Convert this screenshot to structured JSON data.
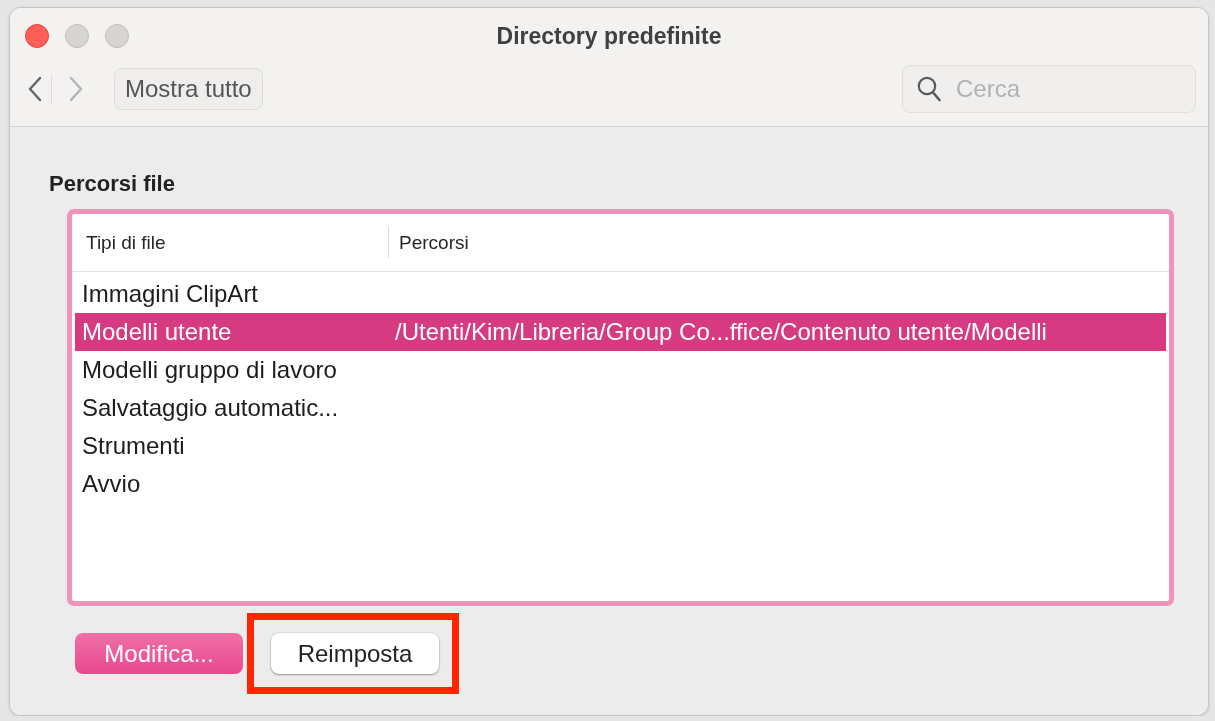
{
  "window": {
    "title": "Directory predefinite",
    "controls": [
      {
        "kind": "close",
        "enabled": true
      },
      {
        "kind": "minimize",
        "enabled": false
      },
      {
        "kind": "zoom",
        "enabled": false
      }
    ]
  },
  "toolbar": {
    "back": {
      "disabled": false
    },
    "forward": {
      "disabled": true
    },
    "show_all_button": "Mostra tutto",
    "search": {
      "placeholder": "Cerca"
    }
  },
  "section": {
    "title": "Percorsi file",
    "table": {
      "columns": [
        "Tipi di file",
        "Percorsi"
      ],
      "rows": [
        {
          "file_type": "Immagini ClipArt",
          "selected": false
        },
        {
          "file_type": "Modelli utente",
          "path": "/Utenti/Kim/Libreria/Group Co...ffice/Contenuto utente/Modelli",
          "selected": true
        },
        {
          "file_type": "Modelli gruppo di lavoro",
          "selected": false
        },
        {
          "file_type": "Salvataggio automatic...",
          "selected": false
        },
        {
          "file_type": "Strumenti",
          "selected": false
        },
        {
          "file_type": "Avvio",
          "selected": false
        }
      ]
    }
  },
  "buttons": [
    {
      "label": "Modifica...",
      "kind": "primary",
      "highlighted": false
    },
    {
      "label": "Reimposta",
      "kind": "default",
      "highlighted": true
    }
  ]
}
